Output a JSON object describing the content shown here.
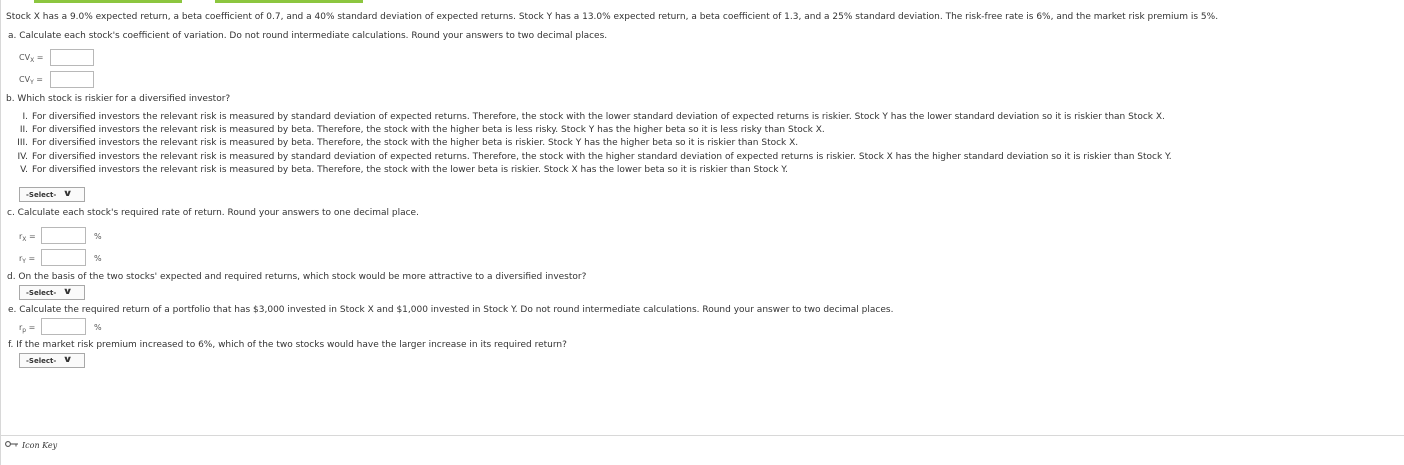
{
  "intro": "Stock X has a 9.0% expected return, a beta coefficient of 0.7, and a 40% standard deviation of expected returns. Stock Y has a 13.0% expected return, a beta coefficient of 1.3, and a 25% standard deviation. The risk-free rate is 6%, and the market risk premium is 5%.",
  "part_a": {
    "prompt": "a. Calculate each stock's coefficient of variation. Do not round intermediate calculations. Round your answers to two decimal places.",
    "cvx_main": "CV",
    "cvx_sub": "X",
    "cvx_eq": " =",
    "cvy_main": "CV",
    "cvy_sub": "Y",
    "cvy_eq": " ="
  },
  "part_b": {
    "prompt": "b. Which stock is riskier for a diversified investor?",
    "options": [
      {
        "num": "I.",
        "text": "For diversified investors the relevant risk is measured by standard deviation of expected returns. Therefore, the stock with the lower standard deviation of expected returns is riskier. Stock Y has the lower standard deviation so it is riskier than Stock X."
      },
      {
        "num": "II.",
        "text": "For diversified investors the relevant risk is measured by beta. Therefore, the stock with the higher beta is less risky. Stock Y has the higher beta so it is less risky than Stock X."
      },
      {
        "num": "III.",
        "text": "For diversified investors the relevant risk is measured by beta. Therefore, the stock with the higher beta is riskier. Stock Y has the higher beta so it is riskier than Stock X."
      },
      {
        "num": "IV.",
        "text": "For diversified investors the relevant risk is measured by standard deviation of expected returns. Therefore, the stock with the higher standard deviation of expected returns is riskier. Stock X has the higher standard deviation so it is riskier than Stock Y."
      },
      {
        "num": "V.",
        "text": "For diversified investors the relevant risk is measured by beta. Therefore, the stock with the lower beta is riskier. Stock X has the lower beta so it is riskier than Stock Y."
      }
    ],
    "select": "-Select-"
  },
  "part_c": {
    "prompt": "c. Calculate each stock's required rate of return. Round your answers to one decimal place.",
    "rx_main": "r",
    "rx_sub": "X",
    "rx_eq": " =",
    "ry_main": "r",
    "ry_sub": "Y",
    "ry_eq": " =",
    "unit": "%"
  },
  "part_d": {
    "prompt": "d. On the basis of the two stocks' expected and required returns, which stock would be more attractive to a diversified investor?",
    "select": "-Select-"
  },
  "part_e": {
    "prompt": "e. Calculate the required return of a portfolio that has $3,000 invested in Stock X and $1,000 invested in Stock Y. Do not round intermediate calculations. Round your answer to two decimal places.",
    "rp_main": "r",
    "rp_sub": "p",
    "rp_eq": " =",
    "unit": "%"
  },
  "part_f": {
    "prompt": "f. If the market risk premium increased to 6%, which of the two stocks would have the larger increase in its required return?",
    "select": "-Select-"
  },
  "footer": {
    "icon_key": "Icon Key",
    "icon": "key-icon"
  },
  "colors": {
    "accent_green": "#8cc63f",
    "text": "#333333",
    "border": "#b8b8b8"
  }
}
